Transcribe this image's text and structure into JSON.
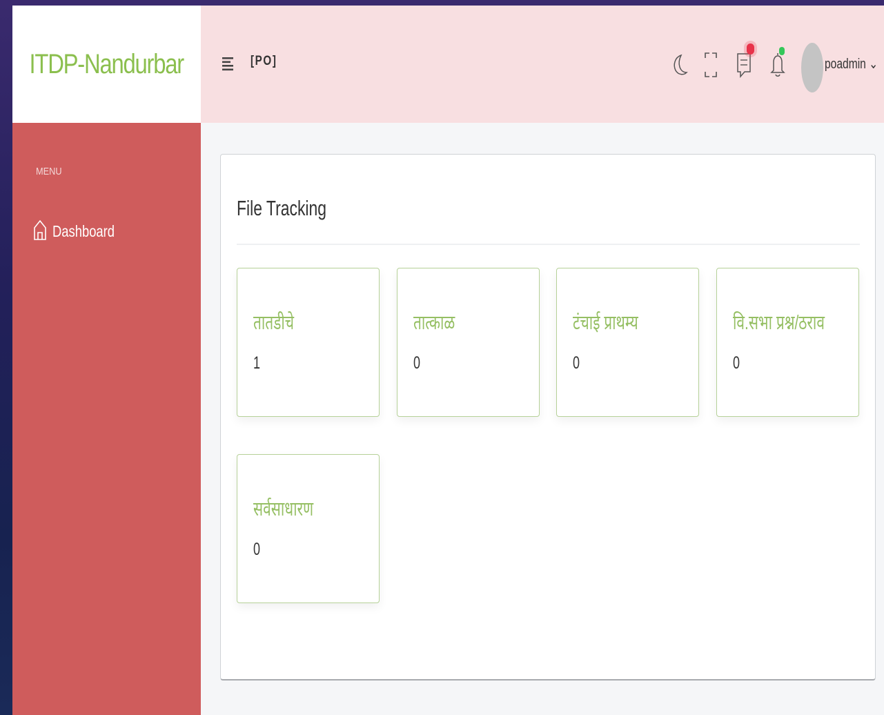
{
  "app": {
    "brand": "ITDP-Nandurbar"
  },
  "header": {
    "role": "[PO]",
    "username": "poadmin",
    "caret": "⌄"
  },
  "icons": {
    "theme": "moon-icon",
    "fullscreen": "fullscreen-icon",
    "messages": "message-icon",
    "notifications": "bell-icon",
    "message_badge_color": "#e8334a",
    "notification_badge_color": "#34c759"
  },
  "sidebar": {
    "menu_title": "MENU",
    "items": [
      {
        "label": "Dashboard",
        "icon": "home-icon"
      }
    ]
  },
  "main": {
    "title": "File Tracking",
    "cards": [
      {
        "label": "तातडीचे",
        "count": "1"
      },
      {
        "label": "तात्काळ",
        "count": "0"
      },
      {
        "label": "टंचाई प्राथम्य",
        "count": "0"
      },
      {
        "label": "वि.सभा प्रश्न/ठराव",
        "count": "0"
      },
      {
        "label": "सर्वसाधारण",
        "count": "0"
      }
    ]
  },
  "colors": {
    "brand_green": "#8bbf4e",
    "sidebar_red": "#cf5c5c",
    "header_pink": "#f8dfe1"
  }
}
